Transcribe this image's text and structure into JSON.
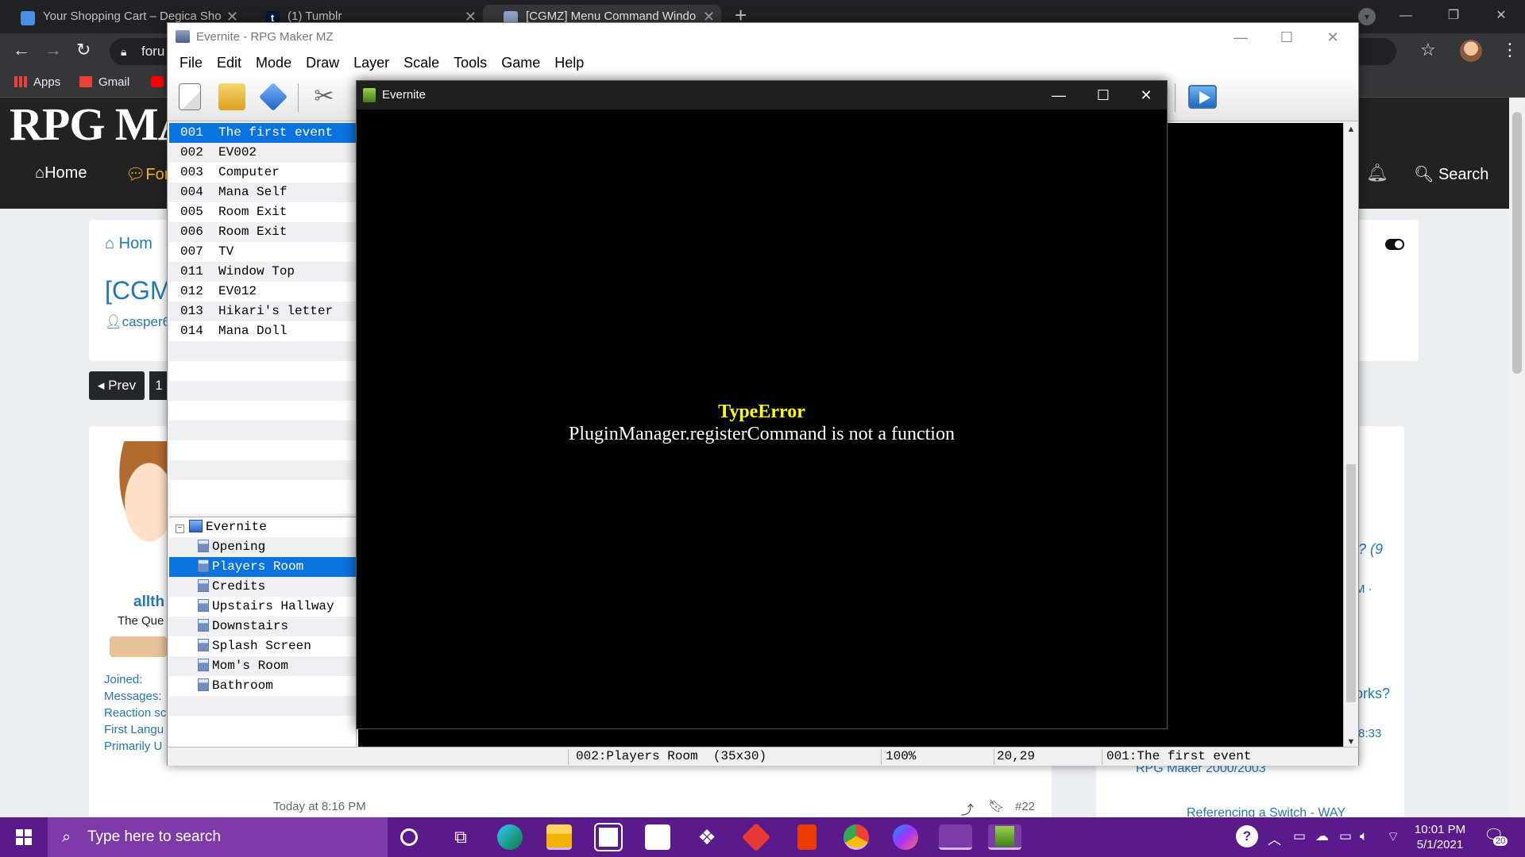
{
  "browser": {
    "tabs": [
      {
        "title": "Your Shopping Cart – Degica Sho",
        "icon": "shopping-icon",
        "color": "#4a90e2"
      },
      {
        "title": "(1) Tumblr",
        "icon": "tumblr-icon",
        "color": "#001935"
      },
      {
        "title": "[CGMZ] Menu Command Windo",
        "icon": "forum-icon",
        "color": "#8ea3c7"
      }
    ],
    "url": "foru",
    "bookmarks": [
      {
        "label": "Apps"
      },
      {
        "label": "Gmail"
      }
    ]
  },
  "site": {
    "logo": "RPG MA",
    "nav_home": "Home",
    "nav_forums": "For",
    "search": "Search",
    "breadcrumb": "Hom",
    "thread_title": "[CGM",
    "thread_author": "casper6",
    "pager_prev": "Prev",
    "pager_page": "1",
    "user_name": "allth",
    "user_title": "The Que",
    "user_stats": [
      "Joined:",
      "Messages:",
      "Reaction sc",
      "First Langu",
      "Primarily U"
    ],
    "post_time": "Today at 8:16 PM",
    "post_number": "#22",
    "side_snippets": [
      "l? (9",
      "M ·",
      "orks?",
      "8:33",
      "RPG Maker 2000/2003",
      "Referencing a Switch - WAY"
    ]
  },
  "editor": {
    "title": "Evernite - RPG Maker MZ",
    "menu": [
      "File",
      "Edit",
      "Mode",
      "Draw",
      "Layer",
      "Scale",
      "Tools",
      "Game",
      "Help"
    ],
    "events": [
      {
        "id": "001",
        "name": "The first event",
        "selected": true
      },
      {
        "id": "002",
        "name": "EV002"
      },
      {
        "id": "003",
        "name": "Computer"
      },
      {
        "id": "004",
        "name": "Mana Self"
      },
      {
        "id": "005",
        "name": "Room Exit"
      },
      {
        "id": "006",
        "name": "Room Exit"
      },
      {
        "id": "007",
        "name": "TV"
      },
      {
        "id": "011",
        "name": "Window Top"
      },
      {
        "id": "012",
        "name": "EV012"
      },
      {
        "id": "013",
        "name": "Hikari's letter"
      },
      {
        "id": "014",
        "name": "Mana Doll"
      }
    ],
    "project_name": "Evernite",
    "maps": [
      {
        "name": "Opening"
      },
      {
        "name": "Players Room",
        "selected": true
      },
      {
        "name": "Credits"
      },
      {
        "name": "Upstairs Hallway"
      },
      {
        "name": "Downstairs"
      },
      {
        "name": "Splash Screen"
      },
      {
        "name": "Mom's Room"
      },
      {
        "name": "Bathroom"
      }
    ],
    "status": {
      "map": "002:Players Room  (35x30)",
      "zoom": "100%",
      "coords": "20,29",
      "event": "001:The first event"
    }
  },
  "game": {
    "title": "Evernite",
    "error_name": "TypeError",
    "error_message": "PluginManager.registerCommand is not a function"
  },
  "taskbar": {
    "search_placeholder": "Type here to search",
    "time": "10:01 PM",
    "date": "5/1/2021",
    "notifications": "20",
    "accent": "#5b1a8b"
  }
}
